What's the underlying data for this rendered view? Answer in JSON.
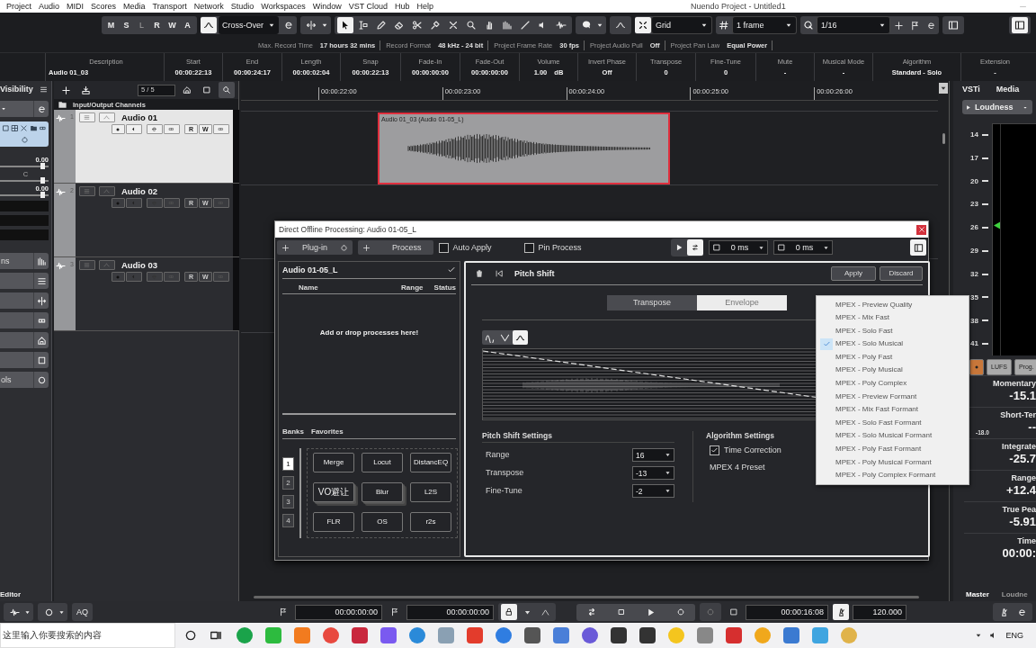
{
  "window": {
    "title": "Nuendo Project - Untitled1"
  },
  "menu": [
    "Project",
    "Audio",
    "MIDI",
    "Scores",
    "Media",
    "Transport",
    "Network",
    "Studio",
    "Workspaces",
    "Window",
    "VST Cloud",
    "Hub",
    "Help"
  ],
  "toolbar": {
    "state_buttons": [
      {
        "label": "M",
        "disabled": false
      },
      {
        "label": "S",
        "disabled": false
      },
      {
        "label": "L",
        "disabled": true
      },
      {
        "label": "R",
        "disabled": false
      },
      {
        "label": "W",
        "disabled": false
      },
      {
        "label": "A",
        "disabled": false
      }
    ],
    "automation_mode": "Cross-Over",
    "snap_type": "Grid",
    "grid": "1 frame",
    "quantize": "1/16"
  },
  "status_line": [
    {
      "label": "Max. Record Time",
      "value": "17 hours 32 mins"
    },
    {
      "label": "Record Format",
      "value": "48 kHz - 24 bit"
    },
    {
      "label": "Project Frame Rate",
      "value": "30 fps"
    },
    {
      "label": "Project Audio Pull",
      "value": "Off"
    },
    {
      "label": "Project Pan Law",
      "value": "Equal Power"
    }
  ],
  "info_line": [
    {
      "label": "Description",
      "value": "Audio 01_03"
    },
    {
      "label": "Start",
      "value": "00:00:22:13"
    },
    {
      "label": "End",
      "value": "00:00:24:17"
    },
    {
      "label": "Length",
      "value": "00:00:02:04"
    },
    {
      "label": "Snap",
      "value": "00:00:22:13"
    },
    {
      "label": "Fade-In",
      "value": "00:00:00:00"
    },
    {
      "label": "Fade-Out",
      "value": "00:00:00:00"
    },
    {
      "label": "Volume",
      "value": "1.00",
      "unit": "dB"
    },
    {
      "label": "Invert Phase",
      "value": "Off"
    },
    {
      "label": "Transpose",
      "value": "0"
    },
    {
      "label": "Fine-Tune",
      "value": "0"
    },
    {
      "label": "Mute",
      "value": "-"
    },
    {
      "label": "Musical Mode",
      "value": "-"
    },
    {
      "label": "Algorithm",
      "value": "Standard - Solo"
    },
    {
      "label": "Extension",
      "value": "-"
    }
  ],
  "inspector": {
    "title": "Visibility",
    "values": [
      "0.00",
      "C",
      "0.00"
    ],
    "sections": [
      {
        "kind": "labeled",
        "label": "ns"
      },
      {
        "kind": "blank"
      },
      {
        "kind": "blank"
      },
      {
        "kind": "blank"
      },
      {
        "kind": "blank"
      },
      {
        "kind": "blank"
      },
      {
        "kind": "labeled",
        "label": "ols"
      }
    ],
    "footer": "Editor"
  },
  "track_list": {
    "counter": "5 / 5",
    "folder": "Input/Output Channels",
    "tracks": [
      {
        "number": "1",
        "name": "Audio 01",
        "selected": true,
        "record_armed": true,
        "controls": [
          "R",
          "W"
        ]
      },
      {
        "number": "2",
        "name": "Audio 02",
        "selected": false,
        "record_armed": false,
        "controls": [
          "R",
          "W"
        ]
      },
      {
        "number": "3",
        "name": "Audio 03",
        "selected": false,
        "record_armed": false,
        "controls": [
          "R",
          "W"
        ]
      }
    ]
  },
  "ruler": [
    "00:00:22:00",
    "00:00:23:00",
    "00:00:24:00",
    "00:00:25:00",
    "00:00:26:00"
  ],
  "event": {
    "name": "Audio 01_03 (Audio 01-05_L)",
    "selected": true
  },
  "dialog": {
    "title": "Direct Offline Processing: Audio 01-05_L",
    "plugin_button": "Plug-in",
    "process_button": "Process",
    "options": [
      {
        "label": "Auto Apply",
        "checked": false
      },
      {
        "label": "Pin Process",
        "checked": false
      }
    ],
    "pre_roll": "0 ms",
    "post_roll": "0 ms",
    "clip": "Audio 01-05_L",
    "columns": [
      "Name",
      "Range",
      "Status"
    ],
    "empty_hint": "Add or drop processes here!",
    "lower_tabs": [
      "Banks",
      "Favorites"
    ],
    "banks": [
      {
        "label": "1",
        "selected": true
      },
      {
        "label": "2",
        "selected": false
      },
      {
        "label": "3",
        "selected": false
      },
      {
        "label": "4",
        "selected": false
      }
    ],
    "favorites": [
      {
        "label": "Merge",
        "kind": "single"
      },
      {
        "label": "Locut",
        "kind": "single"
      },
      {
        "label": "DistancEQ",
        "kind": "single"
      },
      {
        "label": "VO避让",
        "kind": "stack"
      },
      {
        "label": "Blur",
        "kind": "stack"
      },
      {
        "label": "L2S",
        "kind": "single"
      },
      {
        "label": "FLR",
        "kind": "single"
      },
      {
        "label": "OS",
        "kind": "single"
      },
      {
        "label": "r2s",
        "kind": "single"
      }
    ],
    "process": {
      "title": "Pitch Shift",
      "apply": "Apply",
      "discard": "Discard",
      "modes": [
        {
          "label": "Transpose",
          "selected": false
        },
        {
          "label": "Envelope",
          "selected": true
        }
      ],
      "curve_types": [
        {
          "selected": false
        },
        {
          "selected": false
        },
        {
          "selected": true
        }
      ],
      "pitch_settings": {
        "title": "Pitch Shift Settings",
        "fields": [
          {
            "label": "Range",
            "value": "16"
          },
          {
            "label": "Transpose",
            "value": "-13"
          },
          {
            "label": "Fine-Tune",
            "value": "-2"
          }
        ]
      },
      "algorithm": {
        "title": "Algorithm Settings",
        "time_correction": {
          "label": "Time Correction",
          "checked": true
        },
        "preset_label": "MPEX 4 Preset"
      }
    }
  },
  "dropdown": {
    "items": [
      {
        "label": "MPEX - Preview Quality",
        "selected": false
      },
      {
        "label": "MPEX - Mix Fast",
        "selected": false
      },
      {
        "label": "MPEX - Solo Fast",
        "selected": false
      },
      {
        "label": "MPEX - Solo Musical",
        "selected": true
      },
      {
        "label": "MPEX - Poly Fast",
        "selected": false
      },
      {
        "label": "MPEX - Poly Musical",
        "selected": false
      },
      {
        "label": "MPEX - Poly Complex",
        "selected": false
      },
      {
        "label": "MPEX - Preview Formant",
        "selected": false
      },
      {
        "label": "MPEX - Mix Fast Formant",
        "selected": false
      },
      {
        "label": "MPEX - Solo Fast Formant",
        "selected": false
      },
      {
        "label": "MPEX - Solo Musical Formant",
        "selected": false
      },
      {
        "label": "MPEX - Poly Fast Formant",
        "selected": false
      },
      {
        "label": "MPEX - Poly Musical Formant",
        "selected": false
      },
      {
        "label": "MPEX - Poly Complex Formant",
        "selected": false
      }
    ]
  },
  "right_zone": {
    "tabs": [
      "VSTi",
      "Media"
    ],
    "panel": "Loudness",
    "panel_value": "-",
    "scale": [
      "14",
      "17",
      "20",
      "23",
      "26",
      "29",
      "32",
      "35",
      "38",
      "41"
    ],
    "buttons": [
      "LUFS",
      "Prog."
    ],
    "readouts": [
      {
        "label": "Momentary",
        "value": "-15.1"
      },
      {
        "label": "Short-Ter",
        "value": "--",
        "note": "-18.0"
      },
      {
        "label": "Integrate",
        "value": "-25.7"
      },
      {
        "label": "Range",
        "value": "+12.4"
      },
      {
        "label": "True Pea",
        "value": "-5.91"
      },
      {
        "label": "Time",
        "value": "00:00:"
      }
    ],
    "bottom_tabs": [
      {
        "label": "Master",
        "selected": true
      },
      {
        "label": "Loudne",
        "selected": false
      }
    ]
  },
  "transport": {
    "aq": "AQ",
    "left_locator": "00:00:00:00",
    "right_locator": "00:00:00:00",
    "time": "00:00:16:08",
    "tempo": "120.000"
  },
  "taskbar": {
    "search_placeholder": "这里输入你要搜索的内容",
    "language": "ENG"
  }
}
